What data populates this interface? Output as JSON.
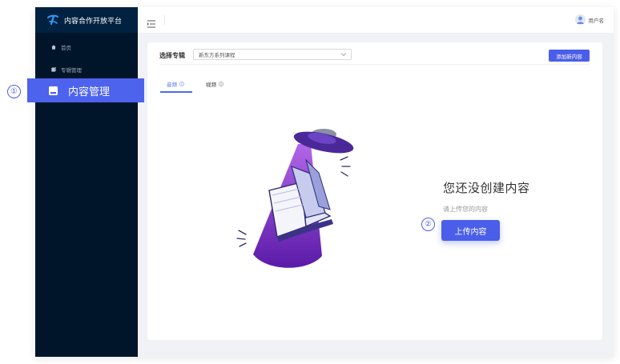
{
  "app": {
    "title": "内容合作开放平台",
    "brand_color": "#4a5eea",
    "sidebar_bg": "#001529"
  },
  "sidebar": {
    "items": [
      {
        "label": "首页",
        "icon": "home-icon"
      },
      {
        "label": "专辑管理",
        "icon": "album-icon"
      },
      {
        "label": "内容管理",
        "icon": "content-icon",
        "active": true
      }
    ]
  },
  "header": {
    "menu_icon": "menu-fold-icon",
    "user_name": "用户名",
    "avatar_icon": "avatar-icon"
  },
  "main": {
    "album_label": "选择专辑",
    "album_selected": "新东方系列课程",
    "add_button": "添加新内容",
    "tabs": [
      {
        "label": "音频",
        "active": true
      },
      {
        "label": "视频",
        "active": false
      }
    ],
    "empty_title": "您还没创建内容",
    "empty_subtitle": "请上传您的内容",
    "upload_button": "上传内容"
  },
  "callouts": [
    "①",
    "②"
  ]
}
